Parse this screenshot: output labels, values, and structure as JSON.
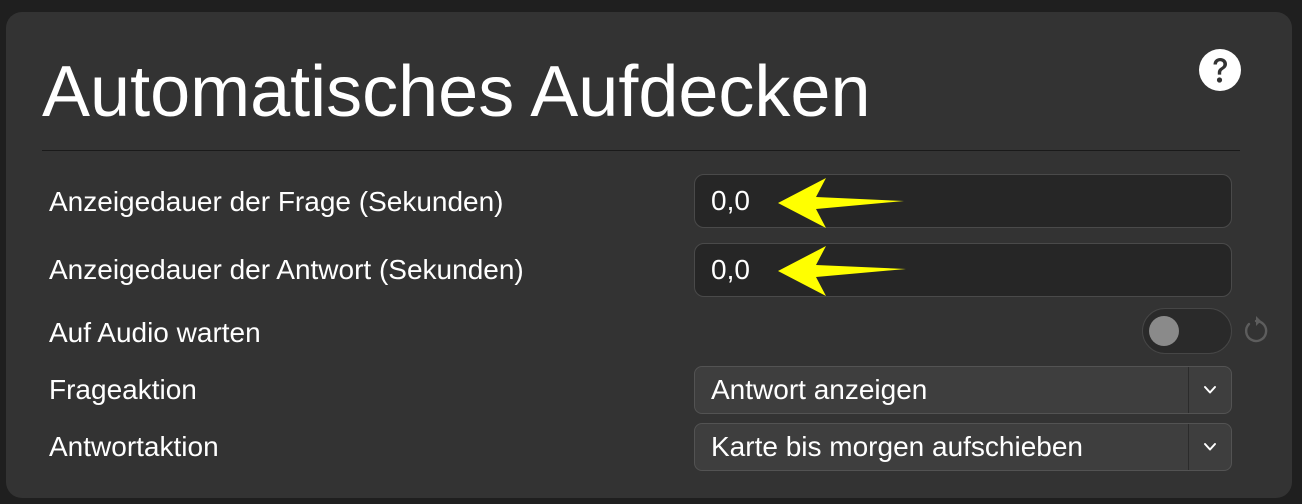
{
  "section": {
    "title": "Automatisches Aufdecken",
    "help_icon": "question-circle-icon"
  },
  "settings": {
    "question_duration": {
      "label": "Anzeigedauer der Frage (Sekunden)",
      "value": "0,0"
    },
    "answer_duration": {
      "label": "Anzeigedauer der Antwort (Sekunden)",
      "value": "0,0"
    },
    "wait_for_audio": {
      "label": "Auf Audio warten",
      "enabled": false,
      "reset_icon": "revert-icon"
    },
    "question_action": {
      "label": "Frageaktion",
      "selected": "Antwort anzeigen"
    },
    "answer_action": {
      "label": "Antwortaktion",
      "selected": "Karte bis morgen aufschieben"
    }
  },
  "annotations": {
    "arrow_color": "#ffff00"
  }
}
